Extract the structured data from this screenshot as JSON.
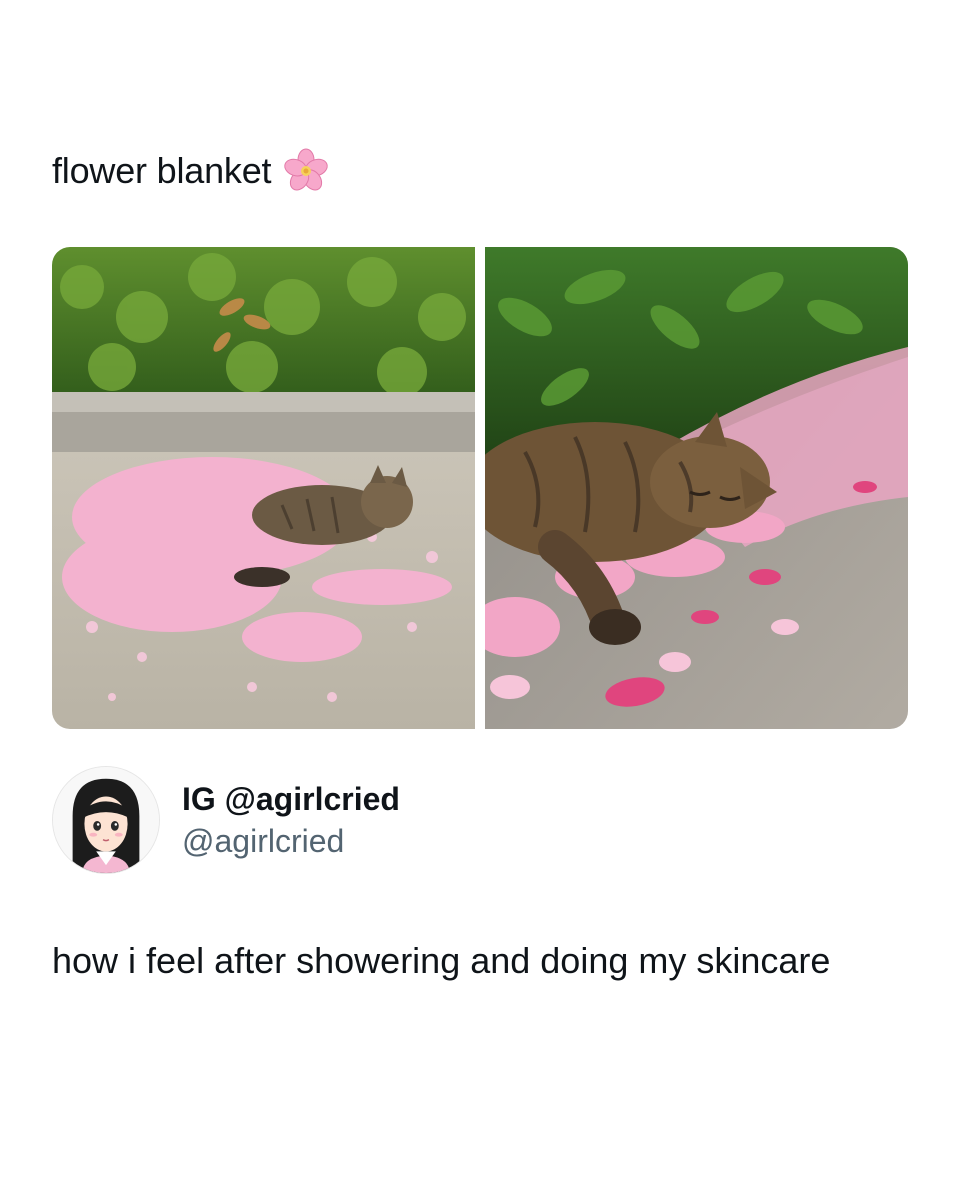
{
  "post": {
    "title": "flower blanket",
    "title_icon": "cherry-blossom-icon",
    "caption": "how i feel after showering and doing my skincare"
  },
  "author": {
    "display_name": "IG @agirlcried",
    "handle": "@agirlcried"
  },
  "colors": {
    "text_primary": "#0f1419",
    "text_secondary": "#536471",
    "background": "#ffffff",
    "petal_pink": "#f2a6c6"
  }
}
